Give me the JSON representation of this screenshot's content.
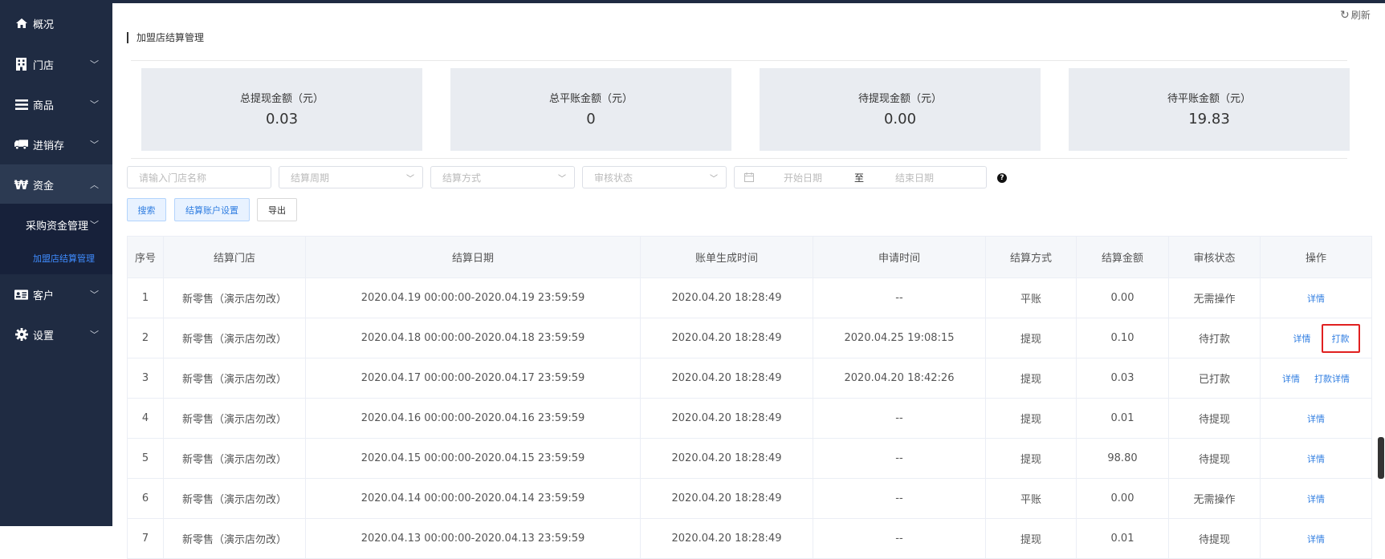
{
  "sidebar": {
    "items": [
      {
        "label": "概况",
        "icon": "home-icon"
      },
      {
        "label": "门店",
        "icon": "store-icon"
      },
      {
        "label": "商品",
        "icon": "list-icon"
      },
      {
        "label": "进销存",
        "icon": "truck-icon"
      },
      {
        "label": "资金",
        "icon": "won-icon"
      },
      {
        "label": "客户",
        "icon": "id-card-icon"
      },
      {
        "label": "设置",
        "icon": "gear-icon"
      }
    ],
    "sub": {
      "group_label": "采购资金管理",
      "active_label": "加盟店结算管理"
    }
  },
  "header": {
    "refresh_label": "刷新",
    "title": "加盟店结算管理"
  },
  "stats": [
    {
      "title": "总提现金额（元）",
      "value": "0.03"
    },
    {
      "title": "总平账金额（元）",
      "value": "0"
    },
    {
      "title": "待提现金额（元）",
      "value": "0.00"
    },
    {
      "title": "待平账金额（元）",
      "value": "19.83"
    }
  ],
  "filters": {
    "store_placeholder": "请输入门店名称",
    "cycle_placeholder": "结算周期",
    "method_placeholder": "结算方式",
    "status_placeholder": "审核状态",
    "start_date_placeholder": "开始日期",
    "range_sep": "至",
    "end_date_placeholder": "结束日期"
  },
  "buttons": {
    "search": "搜索",
    "account_settings": "结算账户设置",
    "export": "导出"
  },
  "table": {
    "headers": [
      "序号",
      "结算门店",
      "结算日期",
      "账单生成时间",
      "申请时间",
      "结算方式",
      "结算金额",
      "审核状态",
      "操作"
    ],
    "rows": [
      {
        "no": "1",
        "store": "新零售（演示店勿改）",
        "period": "2020.04.19 00:00:00-2020.04.19 23:59:59",
        "generated": "2020.04.20 18:28:49",
        "applied": "--",
        "method": "平账",
        "amount": "0.00",
        "status": "无需操作",
        "ops": [
          "详情"
        ]
      },
      {
        "no": "2",
        "store": "新零售（演示店勿改）",
        "period": "2020.04.18 00:00:00-2020.04.18 23:59:59",
        "generated": "2020.04.20 18:28:49",
        "applied": "2020.04.25 19:08:15",
        "method": "提现",
        "amount": "0.10",
        "status": "待打款",
        "ops": [
          "详情",
          "打款"
        ]
      },
      {
        "no": "3",
        "store": "新零售（演示店勿改）",
        "period": "2020.04.17 00:00:00-2020.04.17 23:59:59",
        "generated": "2020.04.20 18:28:49",
        "applied": "2020.04.20 18:42:26",
        "method": "提现",
        "amount": "0.03",
        "status": "已打款",
        "ops": [
          "详情",
          "打款详情"
        ]
      },
      {
        "no": "4",
        "store": "新零售（演示店勿改）",
        "period": "2020.04.16 00:00:00-2020.04.16 23:59:59",
        "generated": "2020.04.20 18:28:49",
        "applied": "--",
        "method": "提现",
        "amount": "0.01",
        "status": "待提现",
        "ops": [
          "详情"
        ]
      },
      {
        "no": "5",
        "store": "新零售（演示店勿改）",
        "period": "2020.04.15 00:00:00-2020.04.15 23:59:59",
        "generated": "2020.04.20 18:28:49",
        "applied": "--",
        "method": "提现",
        "amount": "98.80",
        "status": "待提现",
        "ops": [
          "详情"
        ]
      },
      {
        "no": "6",
        "store": "新零售（演示店勿改）",
        "period": "2020.04.14 00:00:00-2020.04.14 23:59:59",
        "generated": "2020.04.20 18:28:49",
        "applied": "--",
        "method": "平账",
        "amount": "0.00",
        "status": "无需操作",
        "ops": [
          "详情"
        ]
      },
      {
        "no": "7",
        "store": "新零售（演示店勿改）",
        "period": "2020.04.13 00:00:00-2020.04.13 23:59:59",
        "generated": "2020.04.20 18:28:49",
        "applied": "--",
        "method": "提现",
        "amount": "0.01",
        "status": "待提现",
        "ops": [
          "详情"
        ]
      }
    ]
  },
  "colors": {
    "sidebar_bg": "#1f2b42",
    "accent": "#2f7de1",
    "highlight": "#e02020"
  }
}
